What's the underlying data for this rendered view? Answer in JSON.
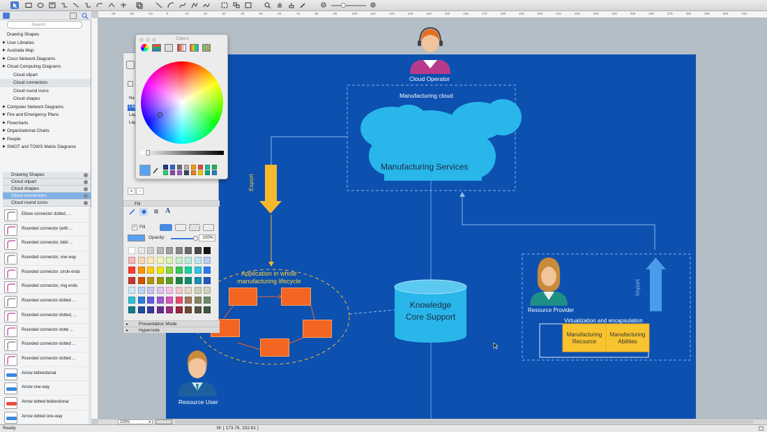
{
  "sidebar": {
    "search_placeholder": "Search",
    "tree": [
      {
        "label": "Drawing Shapes",
        "level": 0,
        "arrow": false
      },
      {
        "label": "User Libraries",
        "level": 0,
        "arrow": true
      },
      {
        "label": "Australia Map",
        "level": 0,
        "arrow": true
      },
      {
        "label": "Cisco Network Diagrams",
        "level": 0,
        "arrow": true
      },
      {
        "label": "Cloud Computing Diagrams",
        "level": 0,
        "arrow": true
      },
      {
        "label": "Cloud clipart",
        "level": 1,
        "arrow": false
      },
      {
        "label": "Cloud connectors",
        "level": 1,
        "arrow": false,
        "selected": true
      },
      {
        "label": "Cloud round icons",
        "level": 1,
        "arrow": false
      },
      {
        "label": "Cloud shapes",
        "level": 1,
        "arrow": false
      },
      {
        "label": "Computer Network Diagrams",
        "level": 0,
        "arrow": true
      },
      {
        "label": "Fire and Emergency Plans",
        "level": 0,
        "arrow": true
      },
      {
        "label": "Flowcharts",
        "level": 0,
        "arrow": true
      },
      {
        "label": "Organizational Charts",
        "level": 0,
        "arrow": true
      },
      {
        "label": "People",
        "level": 0,
        "arrow": true
      },
      {
        "label": "SWOT and TOWS Matrix Diagrams",
        "level": 0,
        "arrow": true
      }
    ],
    "open_libraries": [
      {
        "label": "Drawing Shapes"
      },
      {
        "label": "Cloud clipart"
      },
      {
        "label": "Cloud shapes"
      },
      {
        "label": "Cloud connectors",
        "selected": true
      },
      {
        "label": "Cloud round icons"
      }
    ],
    "shapes": [
      "Elbow connector dotted, ...",
      "Rounded connector (with ...",
      "Rounded connector, bidir ...",
      "Rounded connector, one-way",
      "Rounded connector, circle ends",
      "Rounded connector, ring ends",
      "Rounded connector dotted ...",
      "Rounded connector dotted, ...",
      "Rounded connector dotte ...",
      "Rounded connector dotted ...",
      "Rounded connector dotted ...",
      "Arrow bidirectional",
      "Arrow one-way",
      "Arrow dotted bidirectional",
      "Arrow dotted one-way"
    ]
  },
  "colors_panel": {
    "title": "Colors",
    "brightness": 0.92,
    "swatches": [
      "#1f3a8a",
      "#3a5fcd",
      "#6e6e6e",
      "#b0b0b0",
      "#f39c12",
      "#e74c3c",
      "#1abc9c",
      "#27ae60",
      "#2ecc71",
      "#8e44ad",
      "#9b59b6",
      "#34495e",
      "#e67e22",
      "#f1c40f",
      "#16a085",
      "#2980b9"
    ],
    "current_color": "#5aa0f0"
  },
  "inspector": {
    "name_rows": [
      "Na",
      "Lay",
      "Lay",
      "Lay"
    ],
    "fill_section": "Fill",
    "fill_checkbox": "Fill",
    "opacity_label": "Opacity:",
    "opacity_value": "100%",
    "opacity_fraction": 1.0,
    "presentation_mode": "Presentation Mode",
    "hypernote": "Hypernote",
    "add": "+",
    "remove": "-",
    "palette": [
      [
        "#ffffff",
        "#e6e6e6",
        "#d0d0d0",
        "#b8b8b8",
        "#a0a0a0",
        "#888888",
        "#6a6a6a",
        "#4a4a4a",
        "#151515"
      ],
      [
        "#f7b8b8",
        "#f9d6b0",
        "#fbe9b0",
        "#f6f5b0",
        "#d8f2b0",
        "#bfeec7",
        "#b8ecdf",
        "#bde4f0",
        "#b9cff2"
      ],
      [
        "#ff3b30",
        "#ff9500",
        "#ffcc00",
        "#e8e800",
        "#8cd73a",
        "#35c759",
        "#1ad1a5",
        "#33c3e6",
        "#2c7bf2"
      ],
      [
        "#c0392b",
        "#d35400",
        "#b7950b",
        "#9a9a00",
        "#5c9e1f",
        "#1e8449",
        "#0e8f6e",
        "#1a8fb0",
        "#1f5bbf"
      ],
      [
        "#cfe8f7",
        "#b8d5f5",
        "#c7c5f2",
        "#dcc4f0",
        "#f2c4e6",
        "#f4c7cd",
        "#e6d3c1",
        "#d1cfb8",
        "#cbd5bd"
      ],
      [
        "#2ec1d6",
        "#2f7ed8",
        "#5e5ce6",
        "#9b59d0",
        "#d956b8",
        "#e24d6e",
        "#a0785a",
        "#8a866a",
        "#6f8a6a"
      ],
      [
        "#137a8a",
        "#1c4fa0",
        "#3a37a0",
        "#6a2d8f",
        "#9a2d7b",
        "#9c2442",
        "#6b4a32",
        "#55533f",
        "#3f573f"
      ]
    ]
  },
  "status": {
    "ready": "Ready",
    "zoom": "125%",
    "mouse": "M: [ 173.76, 152.61 ]"
  },
  "diagram": {
    "cloud_operator": "Cloud Operator",
    "manufacturing_cloud": "Manufacturing cloud",
    "manufacturing_services": "Manufacturing Services",
    "export": "Export",
    "import": "Import",
    "application_title_1": "Application in whole",
    "application_title_2": "manufacturing lifecycle",
    "knowledge_1": "Knowledge",
    "knowledge_2": "Core Support",
    "resource_provider": "Resource Provider",
    "virtualization": "Virtualization and encapsulation",
    "manuf_resource_1": "Manufacturing",
    "manuf_resource_2": "Recource",
    "manuf_abilities_1": "Manufacturing",
    "manuf_abilities_2": "Abilities",
    "resource_user": "Resource User"
  },
  "ruler_labels": [
    "-30",
    "-20",
    "-10",
    "0",
    "10",
    "20",
    "30",
    "40",
    "50",
    "60",
    "70",
    "80",
    "90",
    "100",
    "110",
    "120",
    "130",
    "140",
    "150",
    "160",
    "170",
    "180",
    "190",
    "200",
    "210",
    "220",
    "230",
    "240",
    "250",
    "260",
    "270",
    "280",
    "290",
    "300",
    "310"
  ],
  "colors": {
    "page_bg": "#0c50b0",
    "cloud": "#29b6ea",
    "accent_orange": "#f26522",
    "export_arrow": "#f7b92c",
    "import_arrow": "#4a9be8",
    "manufacturing_box": "#f7c430"
  }
}
